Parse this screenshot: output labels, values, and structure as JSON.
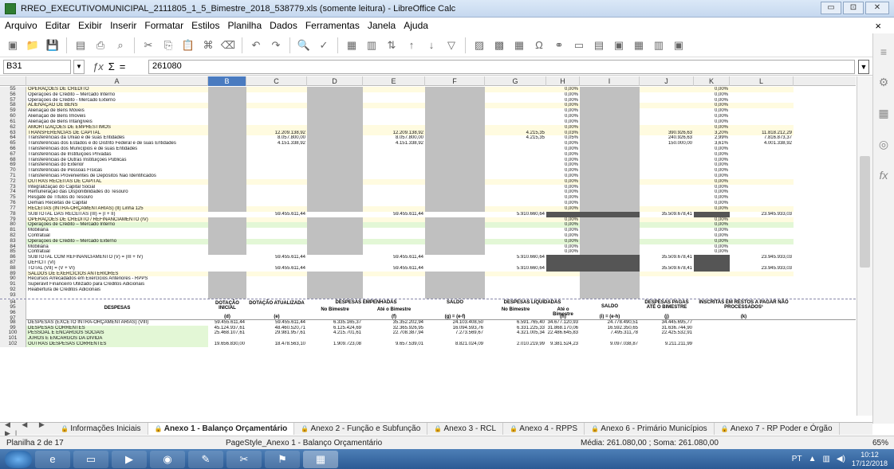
{
  "window": {
    "title": "RREO_EXECUTIVOMUNICIPAL_2111805_1_5_Bimestre_2018_538779.xls (somente leitura) - LibreOffice Calc",
    "min": "▭",
    "max": "⊡",
    "close": "✕"
  },
  "menu": {
    "items": [
      "Arquivo",
      "Editar",
      "Exibir",
      "Inserir",
      "Formatar",
      "Estilos",
      "Planilha",
      "Dados",
      "Ferramentas",
      "Janela",
      "Ajuda"
    ],
    "close": "×"
  },
  "toolbar": {
    "icons": [
      "new-icon",
      "open-icon",
      "save-icon",
      "export-pdf-icon",
      "print-icon",
      "print-preview-icon",
      "cut-icon",
      "copy-icon",
      "paste-icon",
      "clone-icon",
      "clear-icon",
      "undo-icon",
      "redo-icon",
      "find-icon",
      "spelling-icon",
      "row-icon",
      "column-icon",
      "sort-icon",
      "sort-asc-icon",
      "sort-desc-icon",
      "autofilter-icon",
      "image-icon",
      "chart-icon",
      "pivot-icon",
      "special-char-icon",
      "hyperlink-icon",
      "comment-icon",
      "header-footer-icon",
      "define-print-icon",
      "freeze-icon",
      "split-icon",
      "form-icon"
    ]
  },
  "formula": {
    "cell": "B31",
    "value": "261080",
    "sum": "Σ",
    "eq": "="
  },
  "columns": [
    "A",
    "B",
    "C",
    "D",
    "E",
    "F",
    "G",
    "H",
    "I",
    "J",
    "K",
    "L"
  ],
  "rows": [
    {
      "n": "55",
      "a": "OPERAÇÕES DE CRÉDITO",
      "cls": "ylw",
      "h": "0,00%",
      "k": "0,00%"
    },
    {
      "n": "56",
      "a": "    Operações de Crédito – Mercado Interno",
      "h": "0,00%",
      "k": "0,00%"
    },
    {
      "n": "57",
      "a": "    Operações de Crédito - Mercado Externo",
      "h": "0,00%",
      "k": "0,00%"
    },
    {
      "n": "58",
      "a": "ALIENAÇÃO DE BENS",
      "cls": "ylw",
      "h": "0,00%",
      "k": "0,00%"
    },
    {
      "n": "59",
      "a": "    Alienação de Bens Móveis",
      "h": "0,00%",
      "k": "0,00%"
    },
    {
      "n": "60",
      "a": "    Alienação de Bens Imóveis",
      "h": "0,00%",
      "k": "0,00%"
    },
    {
      "n": "61",
      "a": "    Alienação de Bens Intangíveis",
      "h": "0,00%",
      "k": "0,00%"
    },
    {
      "n": "62",
      "a": "AMORTIZAÇÕES DE EMPRÉSTIMOS",
      "cls": "ylw",
      "h": "0,00%",
      "k": "0,00%"
    },
    {
      "n": "63",
      "a": "TRANSFERÊNCIAS DE CAPITAL",
      "cls": "ylw",
      "c": "12.209.138,92",
      "e": "12.209.138,92",
      "g": "4.215,35",
      "h": "0,03%",
      "j": "390.926,63",
      "k": "3,20%",
      "l": "11.818.212,29"
    },
    {
      "n": "64",
      "a": "    Transferências da União e de suas Entidades",
      "c": "8.057.800,00",
      "e": "8.057.800,00",
      "g": "4.215,35",
      "h": "0,05%",
      "j": "240.926,63",
      "k": "2,99%",
      "l": "7.816.873,37"
    },
    {
      "n": "65",
      "a": "    Transferências dos Estados e do Distrito Federal e de suas Entidades",
      "c": "4.151.338,92",
      "e": "4.151.338,92",
      "h": "0,00%",
      "j": "150.000,00",
      "k": "3,61%",
      "l": "4.001.338,92"
    },
    {
      "n": "66",
      "a": "    Transferências dos Municípios e de suas Entidades",
      "h": "0,00%",
      "k": "0,00%"
    },
    {
      "n": "67",
      "a": "    Transferências de Instituições Privadas",
      "h": "0,00%",
      "k": "0,00%"
    },
    {
      "n": "68",
      "a": "    Transferências de Outras Instituições Públicas",
      "h": "0,00%",
      "k": "0,00%"
    },
    {
      "n": "69",
      "a": "    Transferências do Exterior",
      "h": "0,00%",
      "k": "0,00%"
    },
    {
      "n": "70",
      "a": "    Transferências de Pessoas Físicas",
      "h": "0,00%",
      "k": "0,00%"
    },
    {
      "n": "71",
      "a": "    Transferências Provenientes de Depósitos Não Identificados",
      "h": "0,00%",
      "k": "0,00%"
    },
    {
      "n": "72",
      "a": "OUTRAS RECEITAS DE CAPITAL",
      "cls": "ylw",
      "h": "0,00%",
      "k": "0,00%"
    },
    {
      "n": "73",
      "a": "    Integralização do Capital Social",
      "h": "0,00%",
      "k": "0,00%"
    },
    {
      "n": "74",
      "a": "    Remuneração das Disponibilidades do Tesouro",
      "h": "0,00%",
      "k": "0,00%"
    },
    {
      "n": "75",
      "a": "    Resgate de Títulos do Tesouro",
      "h": "0,00%",
      "k": "0,00%"
    },
    {
      "n": "76",
      "a": "    Demais Receitas de Capital",
      "h": "0,00%",
      "k": "0,00%"
    },
    {
      "n": "77",
      "a": "RECEITAS (INTRA-ORÇAMENTÁRIAS) (II)   Linha 125",
      "cls": "ylw",
      "h": "0,00%",
      "k": "0,00%"
    },
    {
      "n": "78",
      "a": "SUBTOTAL DAS RECEITAS (III) = (I + II)",
      "c": "59.455.611,44",
      "e": "59.455.611,44",
      "g": "5.910.660,64",
      "j": "35.509.678,41",
      "l": "23.945.933,03",
      "dark": true
    },
    {
      "n": "79",
      "a": "OPERAÇÕES DE CRÉDITO / REFINANCIAMENTO (IV)",
      "cls": "ylw",
      "h": "0,00%",
      "k": "0,00%"
    },
    {
      "n": "80",
      "a": "  Operações de Crédito – Mercado Interno",
      "cls": "grn",
      "h": "0,00%",
      "k": "0,00%"
    },
    {
      "n": "81",
      "a": "    Mobiliária",
      "h": "0,00%",
      "k": "0,00%"
    },
    {
      "n": "82",
      "a": "    Contratual",
      "h": "0,00%",
      "k": "0,00%"
    },
    {
      "n": "83",
      "a": "  Operações de Crédito – Mercado Externo",
      "cls": "grn",
      "h": "0,00%",
      "k": "0,00%"
    },
    {
      "n": "84",
      "a": "    Mobiliária",
      "h": "0,00%",
      "k": "0,00%"
    },
    {
      "n": "85",
      "a": "    Contratual",
      "h": "0,00%",
      "k": "0,00%"
    },
    {
      "n": "86",
      "a": "SUBTOTAL COM REFINANCIAMENTO (V) = (III + IV)",
      "c": "59.455.611,44",
      "e": "59.455.611,44",
      "g": "5.910.660,64",
      "j": "35.509.678,41",
      "l": "23.945.933,03",
      "dark": true
    },
    {
      "n": "87",
      "a": "DÉFICIT (VI)",
      "dark": true
    },
    {
      "n": "88",
      "a": "TOTAL (VII) = (V + VI)",
      "c": "59.455.611,44",
      "e": "59.455.611,44",
      "g": "5.910.660,64",
      "j": "35.509.678,41",
      "l": "23.945.933,03",
      "dark": true
    },
    {
      "n": "89",
      "a": "SALDOS DE EXERCÍCIOS ANTERIORES",
      "cls": "ylw"
    },
    {
      "n": "90",
      "a": "  Recursos Arrecadados em Exercícios Anteriores - RPPS"
    },
    {
      "n": "91",
      "a": "  Superávit Financeiro Utilizado para Créditos Adicionais"
    },
    {
      "n": "92",
      "a": "  Reabertura de Créditos Adicionais"
    },
    {
      "n": "93",
      "a": ""
    }
  ],
  "despesas_header": {
    "despesas": "DESPESAS",
    "b": "DOTAÇÃO INICIAL",
    "b_sub": "(d)",
    "c": "DOTAÇÃO ATUALIZADA",
    "c_sub": "(e)",
    "empenhadas": "DESPESAS EMPENHADAS",
    "no_bimestre": "No Bimestre",
    "ate_bimestre": "Até o Bimestre",
    "e_sub": "(f)",
    "saldo1": "SALDO",
    "saldo1_sub": "(g) = (e-f)",
    "liquidadas": "DESPESAS LIQUIDADAS",
    "no_bimestre2": "No Bimestre",
    "ate_bimestre2": "Até o Bimestre",
    "h_sub": "(h)",
    "saldo2": "SALDO",
    "saldo2_sub": "(i) = (e-h)",
    "pagas": "DESPESAS PAGAS ATÉ O BIMESTRE",
    "pagas_sub": "(j)",
    "restos": "INSCRITAS EM RESTOS A PAGAR NÃO PROCESSADOS¹",
    "restos_sub": "(k)"
  },
  "despesas_rows": [
    {
      "n": "98",
      "a": "DESPESAS (EXCETO INTRA-ORÇAMENTÁRIAS) (VIII)",
      "b": "59.455.611,44",
      "c": "59.455.611,44",
      "d": "6.335.165,37",
      "e": "35.352.202,94",
      "f": "24.103.408,50",
      "g": "6.591.765,40",
      "h": "34.677.120,93",
      "i": "24.778.490,51",
      "j": "34.445.695,77"
    },
    {
      "n": "99",
      "a": "  DESPESAS CORRENTES",
      "b": "45.124.937,61",
      "c": "48.460.520,71",
      "d": "6.125.424,69",
      "e": "32.365.926,95",
      "f": "16.094.593,76",
      "g": "6.331.225,33",
      "h": "31.868.170,06",
      "i": "16.592.350,65",
      "j": "31.636.744,90"
    },
    {
      "n": "100",
      "a": "    PESSOAL E ENCARGOS SOCIAIS",
      "b": "25.468.107,61",
      "c": "29.981.957,61",
      "d": "4.215.701,61",
      "e": "22.708.387,94",
      "f": "7.273.569,67",
      "g": "4.321.005,34",
      "h": "22.486.645,83",
      "i": "7.495.311,78",
      "j": "22.425.532,91"
    },
    {
      "n": "101",
      "a": "    JUROS E ENCARGOS DA DÍVIDA",
      "b": "",
      "c": "",
      "d": "",
      "e": "",
      "f": "",
      "g": "",
      "h": "",
      "i": "",
      "j": ""
    },
    {
      "n": "102",
      "a": "    OUTRAS DESPESAS CORRENTES",
      "b": "19.656.830,00",
      "c": "18.478.563,10",
      "d": "1.909.723,08",
      "e": "9.657.539,01",
      "f": "8.821.024,09",
      "g": "2.010.219,99",
      "h": "9.381.524,23",
      "i": "9.097.038,87",
      "j": "9.211.211,99"
    }
  ],
  "tabs": {
    "nav": "◀ ◀ ▶ ▶|",
    "items": [
      "Informações Iniciais",
      "Anexo 1 - Balanço Orçamentário",
      "Anexo 2 - Função e Subfunção",
      "Anexo 3 - RCL",
      "Anexo 4 - RPPS",
      "Anexo 6 - Primário Municípios",
      "Anexo 7 - RP Poder e Órgão"
    ],
    "active": 1
  },
  "status": {
    "sheet": "Planilha 2 de 17",
    "style": "PageStyle_Anexo 1 - Balanço Orçamentário",
    "stats": "Média: 261.080,00 ; Soma: 261.080,00",
    "zoom": "65%"
  },
  "taskbar": {
    "lang": "PT",
    "time": "10:12",
    "date": "17/12/2018"
  }
}
